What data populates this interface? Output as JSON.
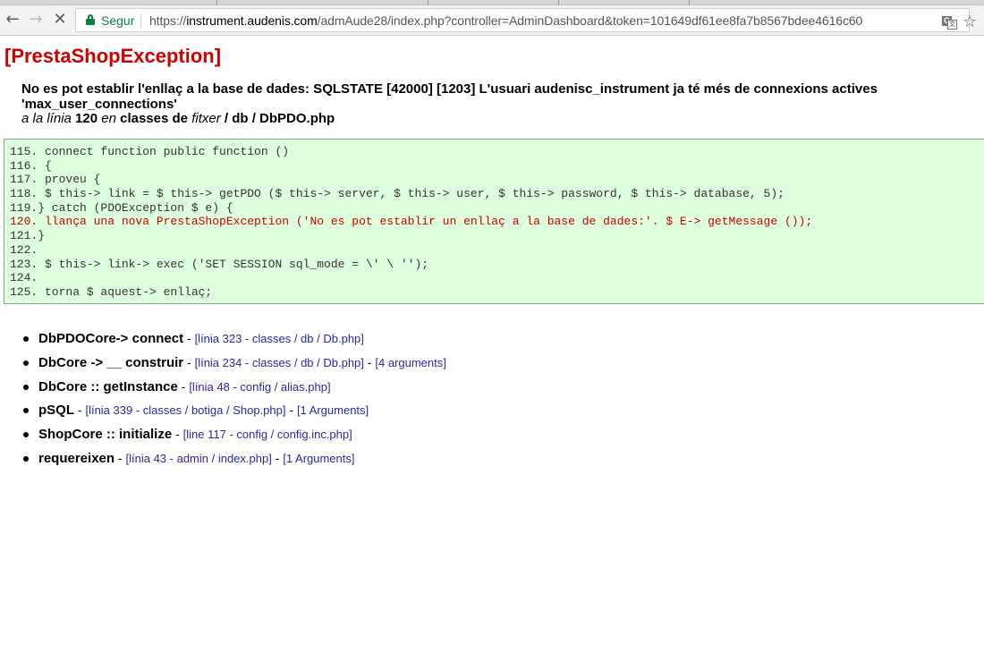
{
  "browser": {
    "secure_label": "Segur",
    "url_prefix": "https://",
    "url_host": "instrument.audenis.com",
    "url_path": "/admAude28/index.php?controller=AdminDashboard&token=101649df61ee8fa7b8567bdee4616c60",
    "back_icon": "arrow-left-icon",
    "forward_icon": "arrow-right-icon",
    "stop_icon": "close-icon",
    "back_glyph": "←",
    "forward_glyph": "→",
    "stop_glyph": "✕",
    "star_glyph": "☆",
    "translate_glyph_a": "G",
    "translate_glyph_b": "文",
    "secure_color": "#0b8043"
  },
  "error": {
    "title": "[PrestaShopException]",
    "message": "No es pot establir l'enllaç a la base de dades: SQLSTATE [42000] [1203] L'usuari audenisc_instrument ja té més de connexions actives 'max_user_connections'",
    "loc_a": "a la línia",
    "loc_line": "120",
    "loc_en": "en",
    "loc_classes_de": "classes de",
    "loc_fitxer": "fitxer",
    "loc_path": "/ db / DbPDO.php",
    "title_color": "#cc0000"
  },
  "code": {
    "lines": [
      "115. connect function public function ()",
      "116. {",
      "117. proveu {",
      "118. $ this-> link = $ this-> getPDO ($ this-> server, $ this-> user, $ this-> password, $ this-> database, 5);",
      "119.} catch (PDOException $ e) {",
      "120. llança una nova PrestaShopException ('No es pot establir un enllaç a la base de dades:'. $ E-> getMessage ());",
      "121.}",
      "122.",
      "123. $ this-> link-> exec ('SET SESSION sql_mode = \\' \\ '');",
      "124.",
      "125. torna $ aquest-> enllaç;"
    ],
    "highlight_index": 5,
    "bg_color": "#ddffdd"
  },
  "trace": [
    {
      "fn": "DbPDOCore-> connect",
      "parts": [
        {
          "sep": " - ",
          "link": "[línia 323 - classes / db / Db.php]"
        }
      ]
    },
    {
      "fn": "DbCore -> __ construir",
      "parts": [
        {
          "sep": " - ",
          "link": "[línia 234 - classes / db / Db.php]"
        },
        {
          "sep": " - ",
          "link": "[4 arguments]"
        }
      ]
    },
    {
      "fn": "DbCore :: getInstance",
      "parts": [
        {
          "sep": " - ",
          "link": "[línia 48 - config / alias.php]"
        }
      ]
    },
    {
      "fn": "pSQL",
      "parts": [
        {
          "sep": " - ",
          "link": "[línia 339 - classes / botiga / Shop.php]"
        },
        {
          "sep": " - ",
          "link": "[1 Arguments]"
        }
      ]
    },
    {
      "fn": "ShopCore :: initialize",
      "parts": [
        {
          "sep": " - ",
          "link": "[line 117 - config / config.inc.php]"
        }
      ]
    },
    {
      "fn": "requereixen",
      "parts": [
        {
          "sep": " - ",
          "link": "[línia 43 - admin / index.php]"
        },
        {
          "sep": " - ",
          "link": "[1 Arguments]"
        }
      ]
    }
  ]
}
